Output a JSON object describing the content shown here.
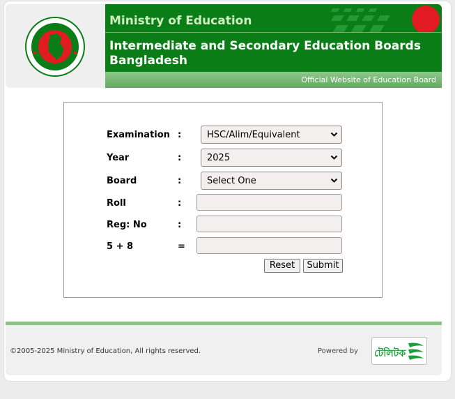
{
  "header": {
    "ministry": "Ministry of Education",
    "boards_line1": "Intermediate and Secondary Education Boards",
    "boards_line2": "Bangladesh",
    "official": "Official Website of Education Board",
    "seal_text_top": "গণপ্রজাতন্ত্রী বাংলাদেশ",
    "seal_text_bottom": "সরকার"
  },
  "form": {
    "fields": [
      {
        "label": "Examination",
        "sep": ":",
        "value": "HSC/Alim/Equivalent"
      },
      {
        "label": "Year",
        "sep": ":",
        "value": "2025"
      },
      {
        "label": "Board",
        "sep": ":",
        "value": "Select One"
      },
      {
        "label": "Roll",
        "sep": ":",
        "value": ""
      },
      {
        "label": "Reg: No",
        "sep": ":",
        "value": ""
      },
      {
        "label": "5 + 8",
        "sep": "=",
        "value": ""
      }
    ],
    "reset_label": "Reset",
    "submit_label": "Submit"
  },
  "footer": {
    "copyright": "©2005-2025 Ministry of Education, All rights reserved.",
    "powered_by": "Powered by",
    "logo_text": "টেলিটক"
  },
  "colors": {
    "header_green": "#0a7d17",
    "accent_light_green": "#86c57f",
    "flag_red": "#e21b22"
  },
  "icons": [
    "government-seal-icon",
    "chevron-down-icon",
    "teletalk-logo-icon"
  ]
}
